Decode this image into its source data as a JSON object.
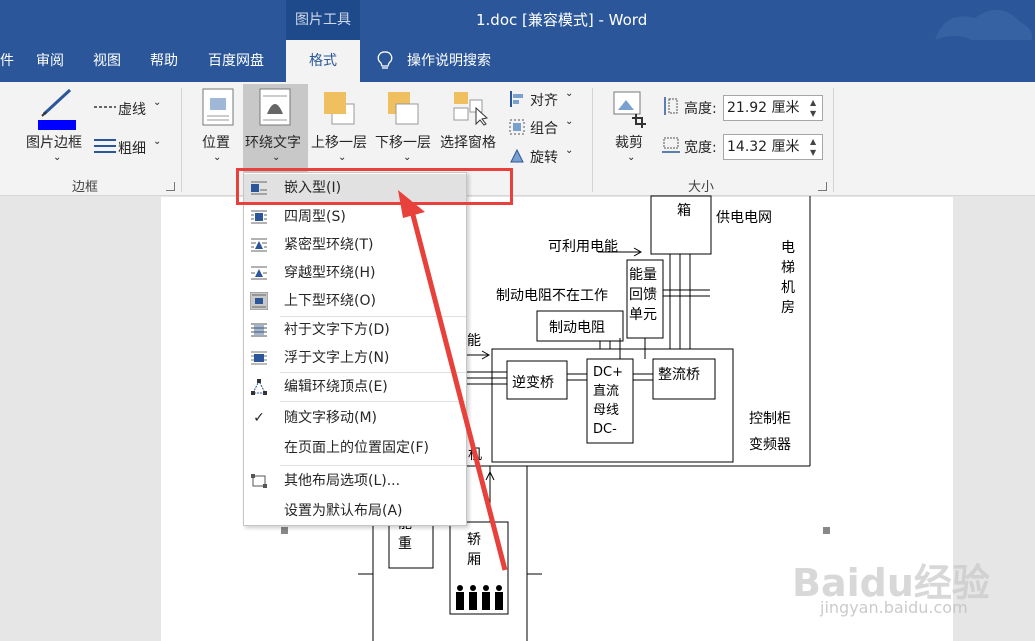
{
  "titlebar": {
    "picture_tools": "图片工具",
    "doc_title": "1.doc [兼容模式]  -  Word"
  },
  "tabs": [
    {
      "label": "件"
    },
    {
      "label": "审阅"
    },
    {
      "label": "视图"
    },
    {
      "label": "帮助"
    },
    {
      "label": "百度网盘"
    },
    {
      "label": "格式"
    },
    {
      "label": "操作说明搜索"
    }
  ],
  "ribbon": {
    "border_group": {
      "picture_border": "图片边框",
      "dash": "虚线",
      "weight": "粗细",
      "group_label": "边框"
    },
    "arrange_group": {
      "position": "位置",
      "wrap_text": "环绕文字",
      "bring_forward": "上移一层",
      "send_backward": "下移一层",
      "selection_pane": "选择窗格",
      "align": "对齐",
      "group": "组合",
      "rotate": "旋转"
    },
    "size_group": {
      "crop": "裁剪",
      "height_label": "高度:",
      "height_value": "21.92 厘米",
      "width_label": "宽度:",
      "width_value": "14.32 厘米",
      "group_label": "大小"
    }
  },
  "wrap_menu": {
    "items": [
      {
        "label": "嵌入型(I)",
        "icon": "inline-wrap-icon"
      },
      {
        "label": "四周型(S)",
        "icon": "square-wrap-icon"
      },
      {
        "label": "紧密型环绕(T)",
        "icon": "tight-wrap-icon"
      },
      {
        "label": "穿越型环绕(H)",
        "icon": "through-wrap-icon"
      },
      {
        "label": "上下型环绕(O)",
        "icon": "top-bottom-wrap-icon"
      },
      {
        "label": "衬于文字下方(D)",
        "icon": "behind-text-icon"
      },
      {
        "label": "浮于文字上方(N)",
        "icon": "in-front-text-icon"
      },
      {
        "label": "编辑环绕顶点(E)",
        "icon": "edit-wrap-points-icon"
      },
      {
        "label": "随文字移动(M)",
        "icon": "checkmark-icon"
      },
      {
        "label": "在页面上的位置固定(F)",
        "icon": ""
      },
      {
        "label": "其他布局选项(L)...",
        "icon": "layout-options-icon"
      },
      {
        "label": "设置为默认布局(A)",
        "icon": ""
      }
    ]
  },
  "diagram": {
    "box_top": "箱",
    "grid": "供电电网",
    "usable_energy": "可利用电能",
    "elevator_room": [
      "电",
      "梯",
      "机",
      "房"
    ],
    "feedback_unit": [
      "能量",
      "回馈",
      "单元"
    ],
    "resistor_idle": "制动电阻不在工作",
    "resistor": "制动电阻",
    "partial_neng": "能",
    "inverter": "逆变桥",
    "dc_bus": [
      "DC+",
      "直流",
      "母线",
      "DC-"
    ],
    "rectifier": "整流桥",
    "control_cabinet": "控制柜",
    "converter": "变频器",
    "partial_ji": "机",
    "counterweight": [
      "能",
      "重"
    ],
    "car": [
      "轿",
      "厢"
    ]
  },
  "watermark": {
    "brand": "Baidu经验",
    "url": "jingyan.baidu.com"
  },
  "colors": {
    "accent_blue": "#2b579a",
    "highlight_red": "#e8403a",
    "ribbon_bg": "#f3f3f3"
  }
}
